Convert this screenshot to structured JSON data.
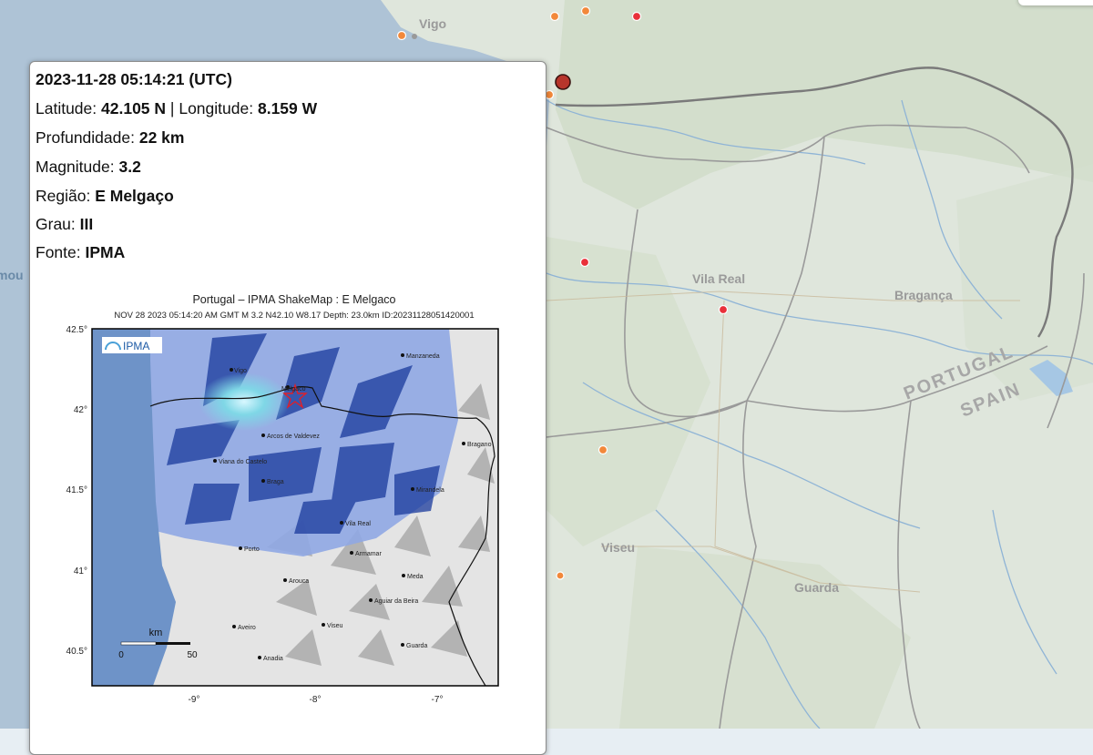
{
  "map": {
    "cities": [
      {
        "name": "Vigo"
      },
      {
        "name": "Vila Real"
      },
      {
        "name": "Bragança"
      },
      {
        "name": "Viseu"
      },
      {
        "name": "Guarda"
      }
    ],
    "border_labels": [
      "PORTUGAL",
      "SPAIN"
    ],
    "edge_label": "mou"
  },
  "popup": {
    "datetime": "2023-11-28 05:14:21 (UTC)",
    "latitude_label": "Latitude:",
    "latitude": "42.105 N",
    "separator": "|",
    "longitude_label": "Longitude:",
    "longitude": "8.159 W",
    "depth_label": "Profundidade:",
    "depth": "22 km",
    "magnitude_label": "Magnitude:",
    "magnitude": "3.2",
    "region_label": "Região:",
    "region": "E Melgaço",
    "grade_label": "Grau:",
    "grade": "III",
    "source_label": "Fonte:",
    "source": "IPMA"
  },
  "shakemap": {
    "title": "Portugal – IPMA ShakeMap : E  Melgaco",
    "subtitle": "NOV 28 2023 05:14:20 AM GMT   M 3.2    N42.10 W8.17    Depth: 23.0km    ID:20231128051420001",
    "logo_text": "IPMA",
    "y_ticks": [
      "42.5°",
      "42°",
      "41.5°",
      "41°",
      "40.5°"
    ],
    "x_ticks": [
      "-9°",
      "-8°",
      "-7°"
    ],
    "scale_label": "km",
    "scale_min": "0",
    "scale_max": "50",
    "places": [
      "Melgaco",
      "Manzaneda",
      "Arcos de Valdevez",
      "Bragano",
      "Viana do Castelo",
      "Braga",
      "Mirandela",
      "Vila Real",
      "Porto",
      "Armamar",
      "Meda",
      "Arouca",
      "Aguiar da Beira",
      "Aveiro",
      "Viseu",
      "Guarda",
      "Anadia",
      "Vigo"
    ]
  },
  "colors": {
    "sea": "#aec3d6",
    "land": "#dfe6dc",
    "epicenter_marker": "#b7352b",
    "orange_marker": "#f2883a",
    "red_marker": "#e9303a",
    "shakemap_sea": "#6e93c8",
    "shake_intensity": "#1a3a9c"
  }
}
